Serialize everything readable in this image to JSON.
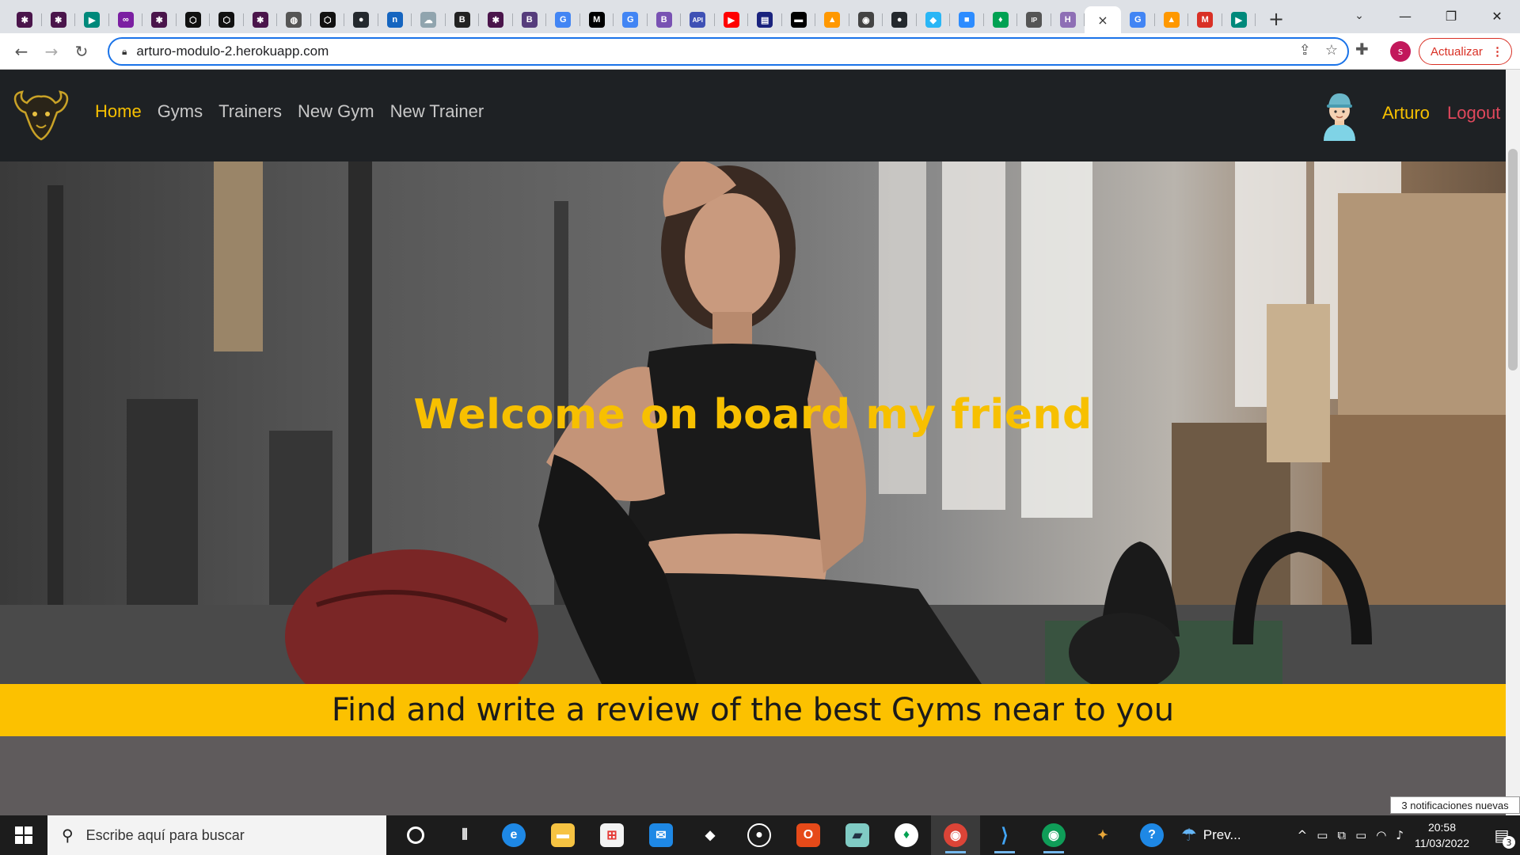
{
  "browser": {
    "tabs": [
      {
        "icon": "slack-icon",
        "glyph": "✱",
        "color": "#4a154b"
      },
      {
        "icon": "slack-icon",
        "glyph": "✱",
        "color": "#4a154b"
      },
      {
        "icon": "meet-icon",
        "glyph": "▶",
        "color": "#00897b"
      },
      {
        "icon": "infinity-icon",
        "glyph": "∞",
        "color": "#7b1fa2"
      },
      {
        "icon": "slack-icon",
        "glyph": "✱",
        "color": "#4a154b"
      },
      {
        "icon": "codepen-icon",
        "glyph": "⬡",
        "color": "#111111"
      },
      {
        "icon": "codepen-icon",
        "glyph": "⬡",
        "color": "#111111"
      },
      {
        "icon": "slack-icon",
        "glyph": "✱",
        "color": "#4a154b"
      },
      {
        "icon": "globe-icon",
        "glyph": "◍",
        "color": "#555555"
      },
      {
        "icon": "codepen-icon",
        "glyph": "⬡",
        "color": "#111111"
      },
      {
        "icon": "github-icon",
        "glyph": "●",
        "color": "#24292e"
      },
      {
        "icon": "notion-icon",
        "glyph": "n",
        "color": "#1565c0"
      },
      {
        "icon": "cloud-icon",
        "glyph": "☁",
        "color": "#90a4ae"
      },
      {
        "icon": "bold-b-icon",
        "glyph": "B",
        "color": "#222222"
      },
      {
        "icon": "slack-icon",
        "glyph": "✱",
        "color": "#4a154b"
      },
      {
        "icon": "bootstrap-icon",
        "glyph": "B",
        "color": "#563d7c"
      },
      {
        "icon": "google-icon",
        "glyph": "G",
        "color": "#4285f4"
      },
      {
        "icon": "medium-icon",
        "glyph": "M",
        "color": "#000000"
      },
      {
        "icon": "google-icon",
        "glyph": "G",
        "color": "#4285f4"
      },
      {
        "icon": "bootstrap-icon",
        "glyph": "B",
        "color": "#7952b3"
      },
      {
        "icon": "api-icon",
        "glyph": "API",
        "color": "#3f51b5"
      },
      {
        "icon": "youtube-icon",
        "glyph": "▶",
        "color": "#ff0000"
      },
      {
        "icon": "document-icon",
        "glyph": "▤",
        "color": "#1a237e"
      },
      {
        "icon": "terminal-icon",
        "glyph": "▬",
        "color": "#000000"
      },
      {
        "icon": "fire-icon",
        "glyph": "▲",
        "color": "#ff9800"
      },
      {
        "icon": "chrome-icon",
        "glyph": "◉",
        "color": "#444444"
      },
      {
        "icon": "github-icon",
        "glyph": "●",
        "color": "#24292e"
      },
      {
        "icon": "chat-icon",
        "glyph": "◆",
        "color": "#29b6f6"
      },
      {
        "icon": "zoom-icon",
        "glyph": "■",
        "color": "#2d8cff"
      },
      {
        "icon": "leaf-icon",
        "glyph": "♦",
        "color": "#00a152"
      },
      {
        "icon": "ip-icon",
        "glyph": "IP",
        "color": "#555555"
      },
      {
        "icon": "h-icon",
        "glyph": "H",
        "color": "#8e6fb5"
      }
    ],
    "tabs_after_active": [
      {
        "icon": "google-icon",
        "glyph": "G",
        "color": "#4285f4"
      },
      {
        "icon": "fire-icon",
        "glyph": "▲",
        "color": "#ff9800"
      },
      {
        "icon": "gmail-icon",
        "glyph": "M",
        "color": "#d93025"
      },
      {
        "icon": "meet-icon",
        "glyph": "▶",
        "color": "#00897b"
      }
    ],
    "active_tab_close": "×",
    "new_tab": "+",
    "url": "arturo-modulo-2.herokuapp.com",
    "profile_initial": "s",
    "update_label": "Actualizar"
  },
  "site": {
    "nav": {
      "links": [
        {
          "label": "Home",
          "active": true
        },
        {
          "label": "Gyms"
        },
        {
          "label": "Trainers"
        },
        {
          "label": "New Gym"
        },
        {
          "label": "New Trainer"
        }
      ],
      "user_name": "Arturo",
      "logout": "Logout"
    },
    "hero_title": "Welcome on board my friend",
    "banner_text": "Find and write a review of the best Gyms near to you",
    "colors": {
      "accent": "#f7c000",
      "navbar": "#1e2124",
      "banner": "#fcc100",
      "logout": "#e0485c"
    }
  },
  "taskbar": {
    "search_placeholder": "Escribe aquí para buscar",
    "weather_label": "Prev...",
    "time": "20:58",
    "date": "11/03/2022",
    "notifications_toast": "3 notificaciones nuevas",
    "notification_count": "3"
  }
}
